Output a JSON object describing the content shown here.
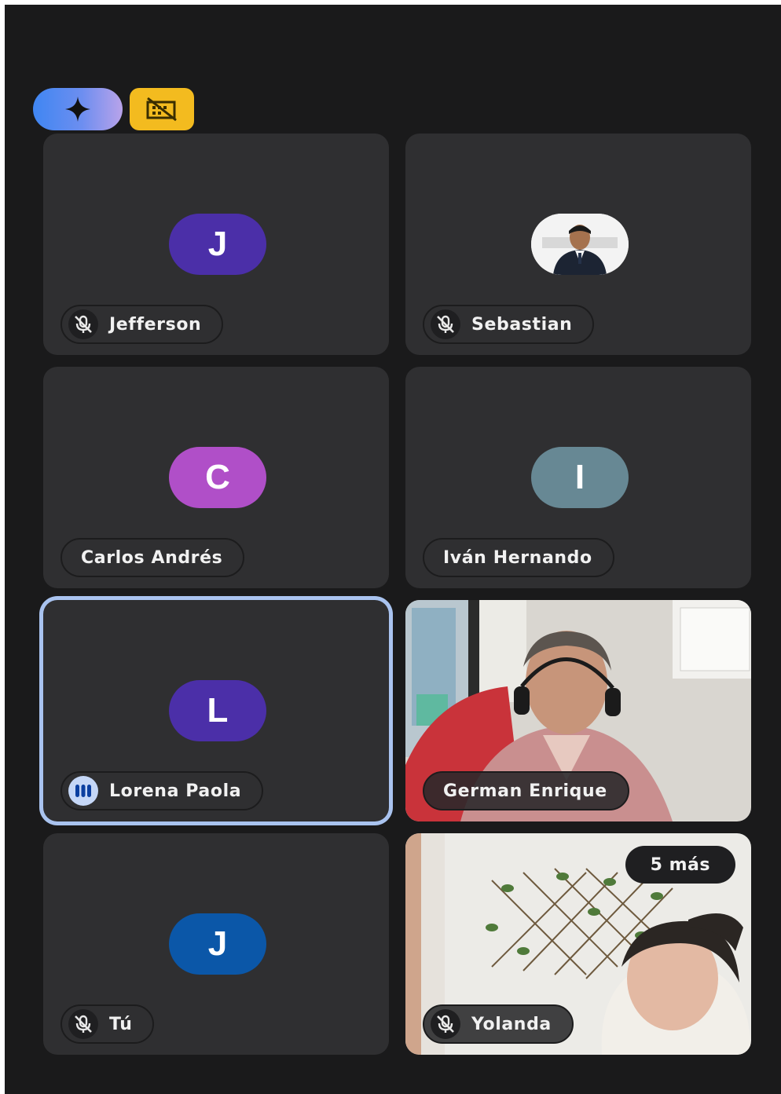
{
  "top_bar": {
    "gemini_icon": "sparkle-icon",
    "host_icon": "no-screen-share-icon",
    "gemini_color": "#3f86f2",
    "host_color": "#f3bb1f"
  },
  "participants": [
    {
      "name": "Jefferson",
      "avatar_letter": "J",
      "avatar_color": "#4b2fa8",
      "mic": "muted"
    },
    {
      "name": "Sebastian",
      "avatar_letter": "",
      "avatar_type": "photo",
      "mic": "muted"
    },
    {
      "name": "Carlos Andrés",
      "avatar_letter": "C",
      "avatar_color": "#b04fc8",
      "mic": "none"
    },
    {
      "name": "Iván Hernando",
      "avatar_letter": "I",
      "avatar_color": "#678894",
      "mic": "none"
    },
    {
      "name": "Lorena Paola",
      "avatar_letter": "L",
      "avatar_color": "#4b2fa8",
      "mic": "speaking",
      "active": true
    },
    {
      "name": "German Enrique",
      "avatar_type": "video",
      "mic": "none"
    },
    {
      "name": "Tú",
      "avatar_letter": "J",
      "avatar_color": "#0b57a8",
      "mic": "muted"
    },
    {
      "name": "Yolanda",
      "avatar_type": "video",
      "mic": "muted",
      "overflow_label": "5 más"
    }
  ],
  "icons": {
    "muted": "mic-off-icon",
    "speaking": "audio-level-icon"
  },
  "colors": {
    "tile": "#2f2f31",
    "background": "#1a1a1b",
    "active_border": "#a9c3ef"
  }
}
